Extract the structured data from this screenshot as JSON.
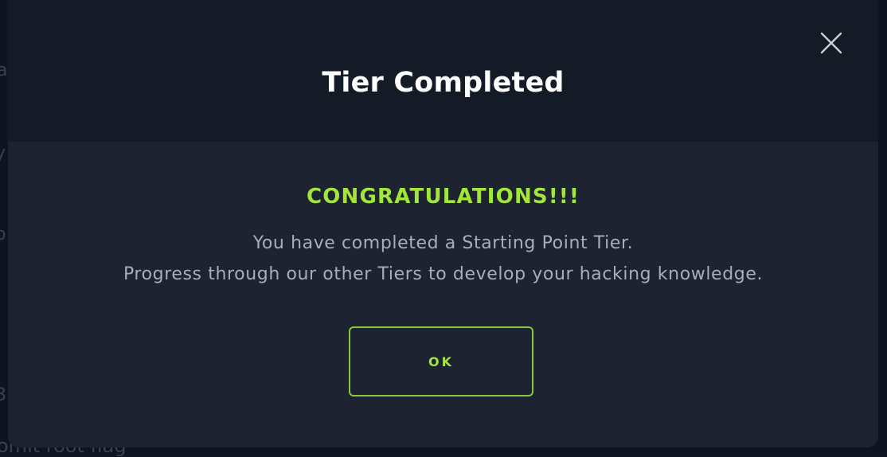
{
  "background": {
    "fragments": [
      "a",
      "y",
      "o",
      "3",
      "omit root flag"
    ]
  },
  "modal": {
    "title": "Tier Completed",
    "close_icon": "close-icon",
    "headline": "CONGRATULATIONS!!!",
    "message_lines": [
      "You have completed a Starting Point Tier.",
      "Progress through our other Tiers to develop your hacking knowledge."
    ],
    "ok_label": "OK"
  },
  "colors": {
    "accent": "#a4e53a",
    "header_bg": "#141a26",
    "body_bg": "#1d2330",
    "text_muted": "#a5afbf"
  }
}
